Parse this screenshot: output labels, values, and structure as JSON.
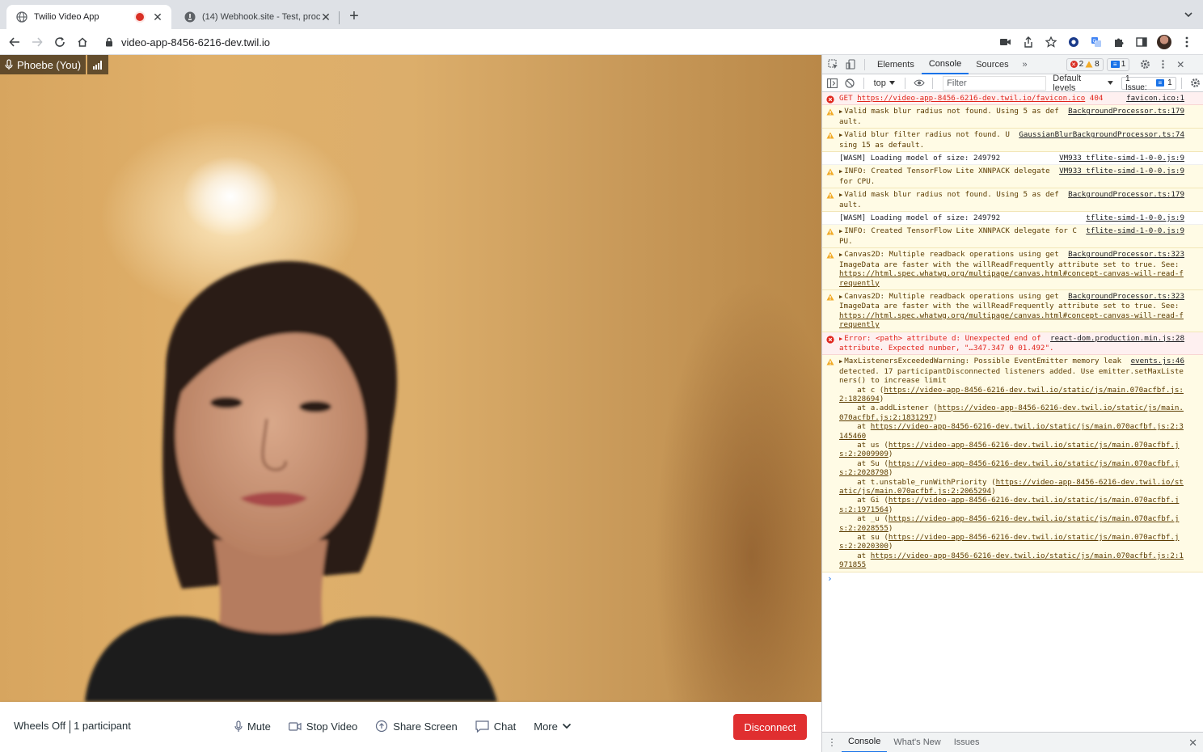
{
  "browser": {
    "tabs": [
      {
        "title": "Twilio Video App",
        "active": true,
        "recording": true
      },
      {
        "title": "(14) Webhook.site - Test, proc",
        "active": false
      }
    ],
    "url": "video-app-8456-6216-dev.twil.io"
  },
  "video": {
    "participant_name": "Phoebe (You)",
    "room_name": "Wheels Off",
    "participant_count": "1 participant",
    "buttons": {
      "mute": "Mute",
      "stop_video": "Stop Video",
      "share_screen": "Share Screen",
      "chat": "Chat",
      "more": "More",
      "disconnect": "Disconnect"
    }
  },
  "devtools": {
    "tabs": [
      "Elements",
      "Console",
      "Sources"
    ],
    "active_tab": "Console",
    "error_count": "2",
    "warning_count": "8",
    "info_count": "1",
    "context": "top",
    "filter_placeholder": "Filter",
    "levels": "Default levels",
    "issues_label": "1 Issue:",
    "issues_count": "1",
    "drawer_tabs": [
      "Console",
      "What's New",
      "Issues"
    ],
    "messages": [
      {
        "level": "error",
        "expand": false,
        "text": "GET ",
        "link": "https://video-app-8456-6216-dev.twil.io/favicon.ico",
        "after": " 404",
        "src": "favicon.ico:1"
      },
      {
        "level": "warn",
        "expand": true,
        "text": "Valid mask blur radius not found. Using 5 as default.",
        "src": "BackgroundProcessor.ts:179"
      },
      {
        "level": "warn",
        "expand": true,
        "text": "Valid blur filter radius not found. Using 15 as default.",
        "src": "GaussianBlurBackgroundProcessor.ts:74"
      },
      {
        "level": "info",
        "expand": false,
        "text": "[WASM] Loading model of size: 249792",
        "src": "VM933 tflite-simd-1-0-0.js:9"
      },
      {
        "level": "warn",
        "expand": true,
        "text": "INFO: Created TensorFlow Lite XNNPACK delegate for CPU.",
        "src": "VM933 tflite-simd-1-0-0.js:9"
      },
      {
        "level": "warn",
        "expand": true,
        "text": "Valid mask blur radius not found. Using 5 as default.",
        "src": "BackgroundProcessor.ts:179"
      },
      {
        "level": "info",
        "expand": false,
        "text": "[WASM] Loading model of size: 249792",
        "src": "tflite-simd-1-0-0.js:9"
      },
      {
        "level": "warn",
        "expand": true,
        "text": "INFO: Created TensorFlow Lite XNNPACK delegate for CPU.",
        "src": "tflite-simd-1-0-0.js:9"
      },
      {
        "level": "warn",
        "expand": true,
        "text": "Canvas2D: Multiple readback operations using getImageData are faster with the willReadFrequently attribute set to true. See: ",
        "link": "https://html.spec.whatwg.org/multipage/canvas.html#concept-canvas-will-read-frequently",
        "src": "BackgroundProcessor.ts:323"
      },
      {
        "level": "warn",
        "expand": true,
        "text": "Canvas2D: Multiple readback operations using getImageData are faster with the willReadFrequently attribute set to true. See: ",
        "link": "https://html.spec.whatwg.org/multipage/canvas.html#concept-canvas-will-read-frequently",
        "src": "BackgroundProcessor.ts:323"
      },
      {
        "level": "error",
        "expand": true,
        "text": "Error: <path> attribute d: Unexpected end of attribute. Expected number, \"…347.347 0 01.492\".",
        "src": "react-dom.production.min.js:28"
      },
      {
        "level": "warn",
        "expand": true,
        "text": "MaxListenersExceededWarning: Possible EventEmitter memory leak detected. 17 participantDisconnected listeners added. Use emitter.setMaxListeners() to increase limit",
        "src": "events.js:46",
        "stack": [
          {
            "pre": "    at c (",
            "link": "https://video-app-8456-6216-dev.twil.io/static/js/main.070acfbf.js:2:1828694",
            "post": ")"
          },
          {
            "pre": "    at a.addListener (",
            "link": "https://video-app-8456-6216-dev.twil.io/static/js/main.070acfbf.js:2:1831297",
            "post": ")"
          },
          {
            "pre": "    at ",
            "link": "https://video-app-8456-6216-dev.twil.io/static/js/main.070acfbf.js:2:3145460",
            "post": ""
          },
          {
            "pre": "    at us (",
            "link": "https://video-app-8456-6216-dev.twil.io/static/js/main.070acfbf.js:2:2009909",
            "post": ")"
          },
          {
            "pre": "    at Su (",
            "link": "https://video-app-8456-6216-dev.twil.io/static/js/main.070acfbf.js:2:2028798",
            "post": ")"
          },
          {
            "pre": "    at t.unstable_runWithPriority (",
            "link": "https://video-app-8456-6216-dev.twil.io/static/js/main.070acfbf.js:2:2065294",
            "post": ")"
          },
          {
            "pre": "    at Gi (",
            "link": "https://video-app-8456-6216-dev.twil.io/static/js/main.070acfbf.js:2:1971564",
            "post": ")"
          },
          {
            "pre": "    at _u (",
            "link": "https://video-app-8456-6216-dev.twil.io/static/js/main.070acfbf.js:2:2028555",
            "post": ")"
          },
          {
            "pre": "    at su (",
            "link": "https://video-app-8456-6216-dev.twil.io/static/js/main.070acfbf.js:2:2020300",
            "post": ")"
          },
          {
            "pre": "    at ",
            "link": "https://video-app-8456-6216-dev.twil.io/static/js/main.070acfbf.js:2:1971855",
            "post": ""
          }
        ]
      }
    ]
  },
  "colors": {
    "disconnect": "#e02f30",
    "devtools_accent": "#1a73e8",
    "error": "#d93025",
    "warning_bg": "#fffbe5"
  }
}
